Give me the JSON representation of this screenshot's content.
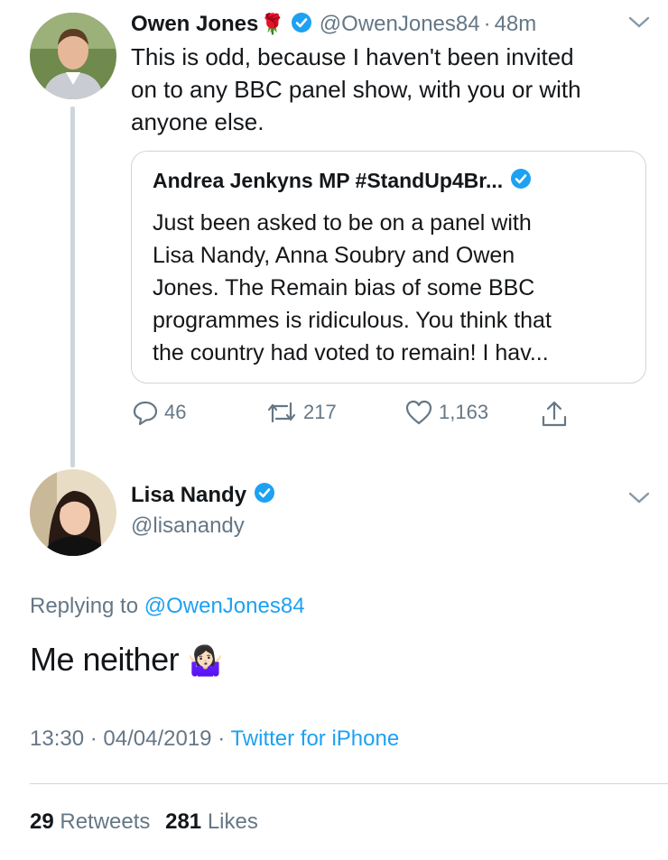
{
  "first_tweet": {
    "name": "Owen Jones",
    "emoji": "🌹",
    "handle": "@OwenJones84",
    "separator": "·",
    "time": "48m",
    "text_lines": [
      "This is odd, because I haven't been invited",
      "on to any BBC panel show, with you or with",
      "anyone else."
    ],
    "quoted": {
      "name": "Andrea Jenkyns MP #StandUp4Br...",
      "text_lines": [
        "Just been asked to be on a panel with",
        "Lisa Nandy, Anna Soubry and Owen",
        "Jones. The Remain bias of some BBC",
        "programmes is ridiculous. You think that",
        "the country had voted to remain! I hav..."
      ]
    },
    "actions": {
      "replies": "46",
      "retweets": "217",
      "likes": "1,163"
    }
  },
  "main_tweet": {
    "name": "Lisa Nandy",
    "handle": "@lisanandy",
    "replying_prefix": "Replying to",
    "replying_to": "@OwenJones84",
    "text": "Me neither",
    "emoji": "🤷🏻‍♀️",
    "time": "13:30",
    "separator": "·",
    "date": "04/04/2019",
    "source": "Twitter for iPhone",
    "stats": {
      "retweets_count": "29",
      "retweets_label": "Retweets",
      "likes_count": "281",
      "likes_label": "Likes"
    }
  },
  "colors": {
    "accent": "#1da1f2",
    "text": "#14171a",
    "secondary": "#657786",
    "border": "#ccd6dd"
  }
}
